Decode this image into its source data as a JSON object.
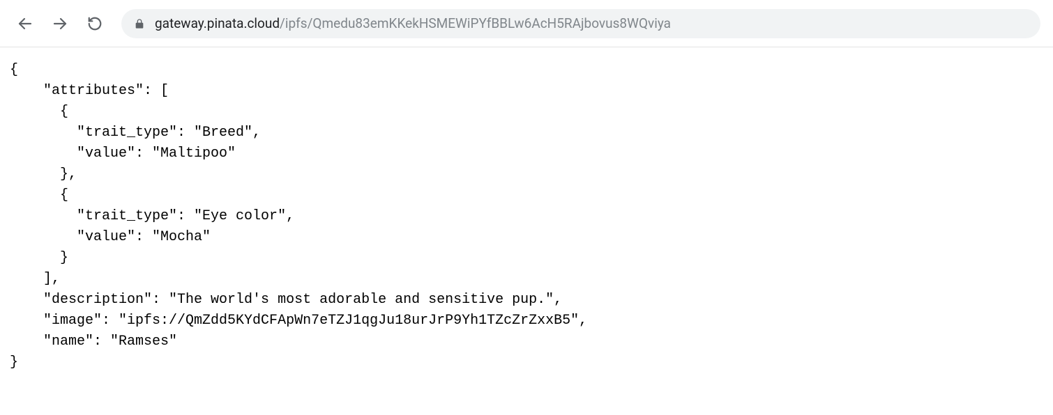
{
  "url": {
    "domain": "gateway.pinata.cloud",
    "path": "/ipfs/Qmedu83emKKekHSMEWiPYfBBLw6AcH5RAjbovus8WQviya"
  },
  "json_body": {
    "line1": "{",
    "line2": "    \"attributes\": [",
    "line3": "      {",
    "line4": "        \"trait_type\": \"Breed\",",
    "line5": "        \"value\": \"Maltipoo\"",
    "line6": "      },",
    "line7": "      {",
    "line8": "        \"trait_type\": \"Eye color\",",
    "line9": "        \"value\": \"Mocha\"",
    "line10": "      }",
    "line11": "    ],",
    "line12": "    \"description\": \"The world's most adorable and sensitive pup.\",",
    "line13": "    \"image\": \"ipfs://QmZdd5KYdCFApWn7eTZJ1qgJu18urJrP9Yh1TZcZrZxxB5\",",
    "line14": "    \"name\": \"Ramses\"",
    "line15": "}"
  },
  "metadata_parsed": {
    "attributes": [
      {
        "trait_type": "Breed",
        "value": "Maltipoo"
      },
      {
        "trait_type": "Eye color",
        "value": "Mocha"
      }
    ],
    "description": "The world's most adorable and sensitive pup.",
    "image": "ipfs://QmZdd5KYdCFApWn7eTZJ1qgJu18urJrP9Yh1TZcZrZxxB5",
    "name": "Ramses"
  }
}
